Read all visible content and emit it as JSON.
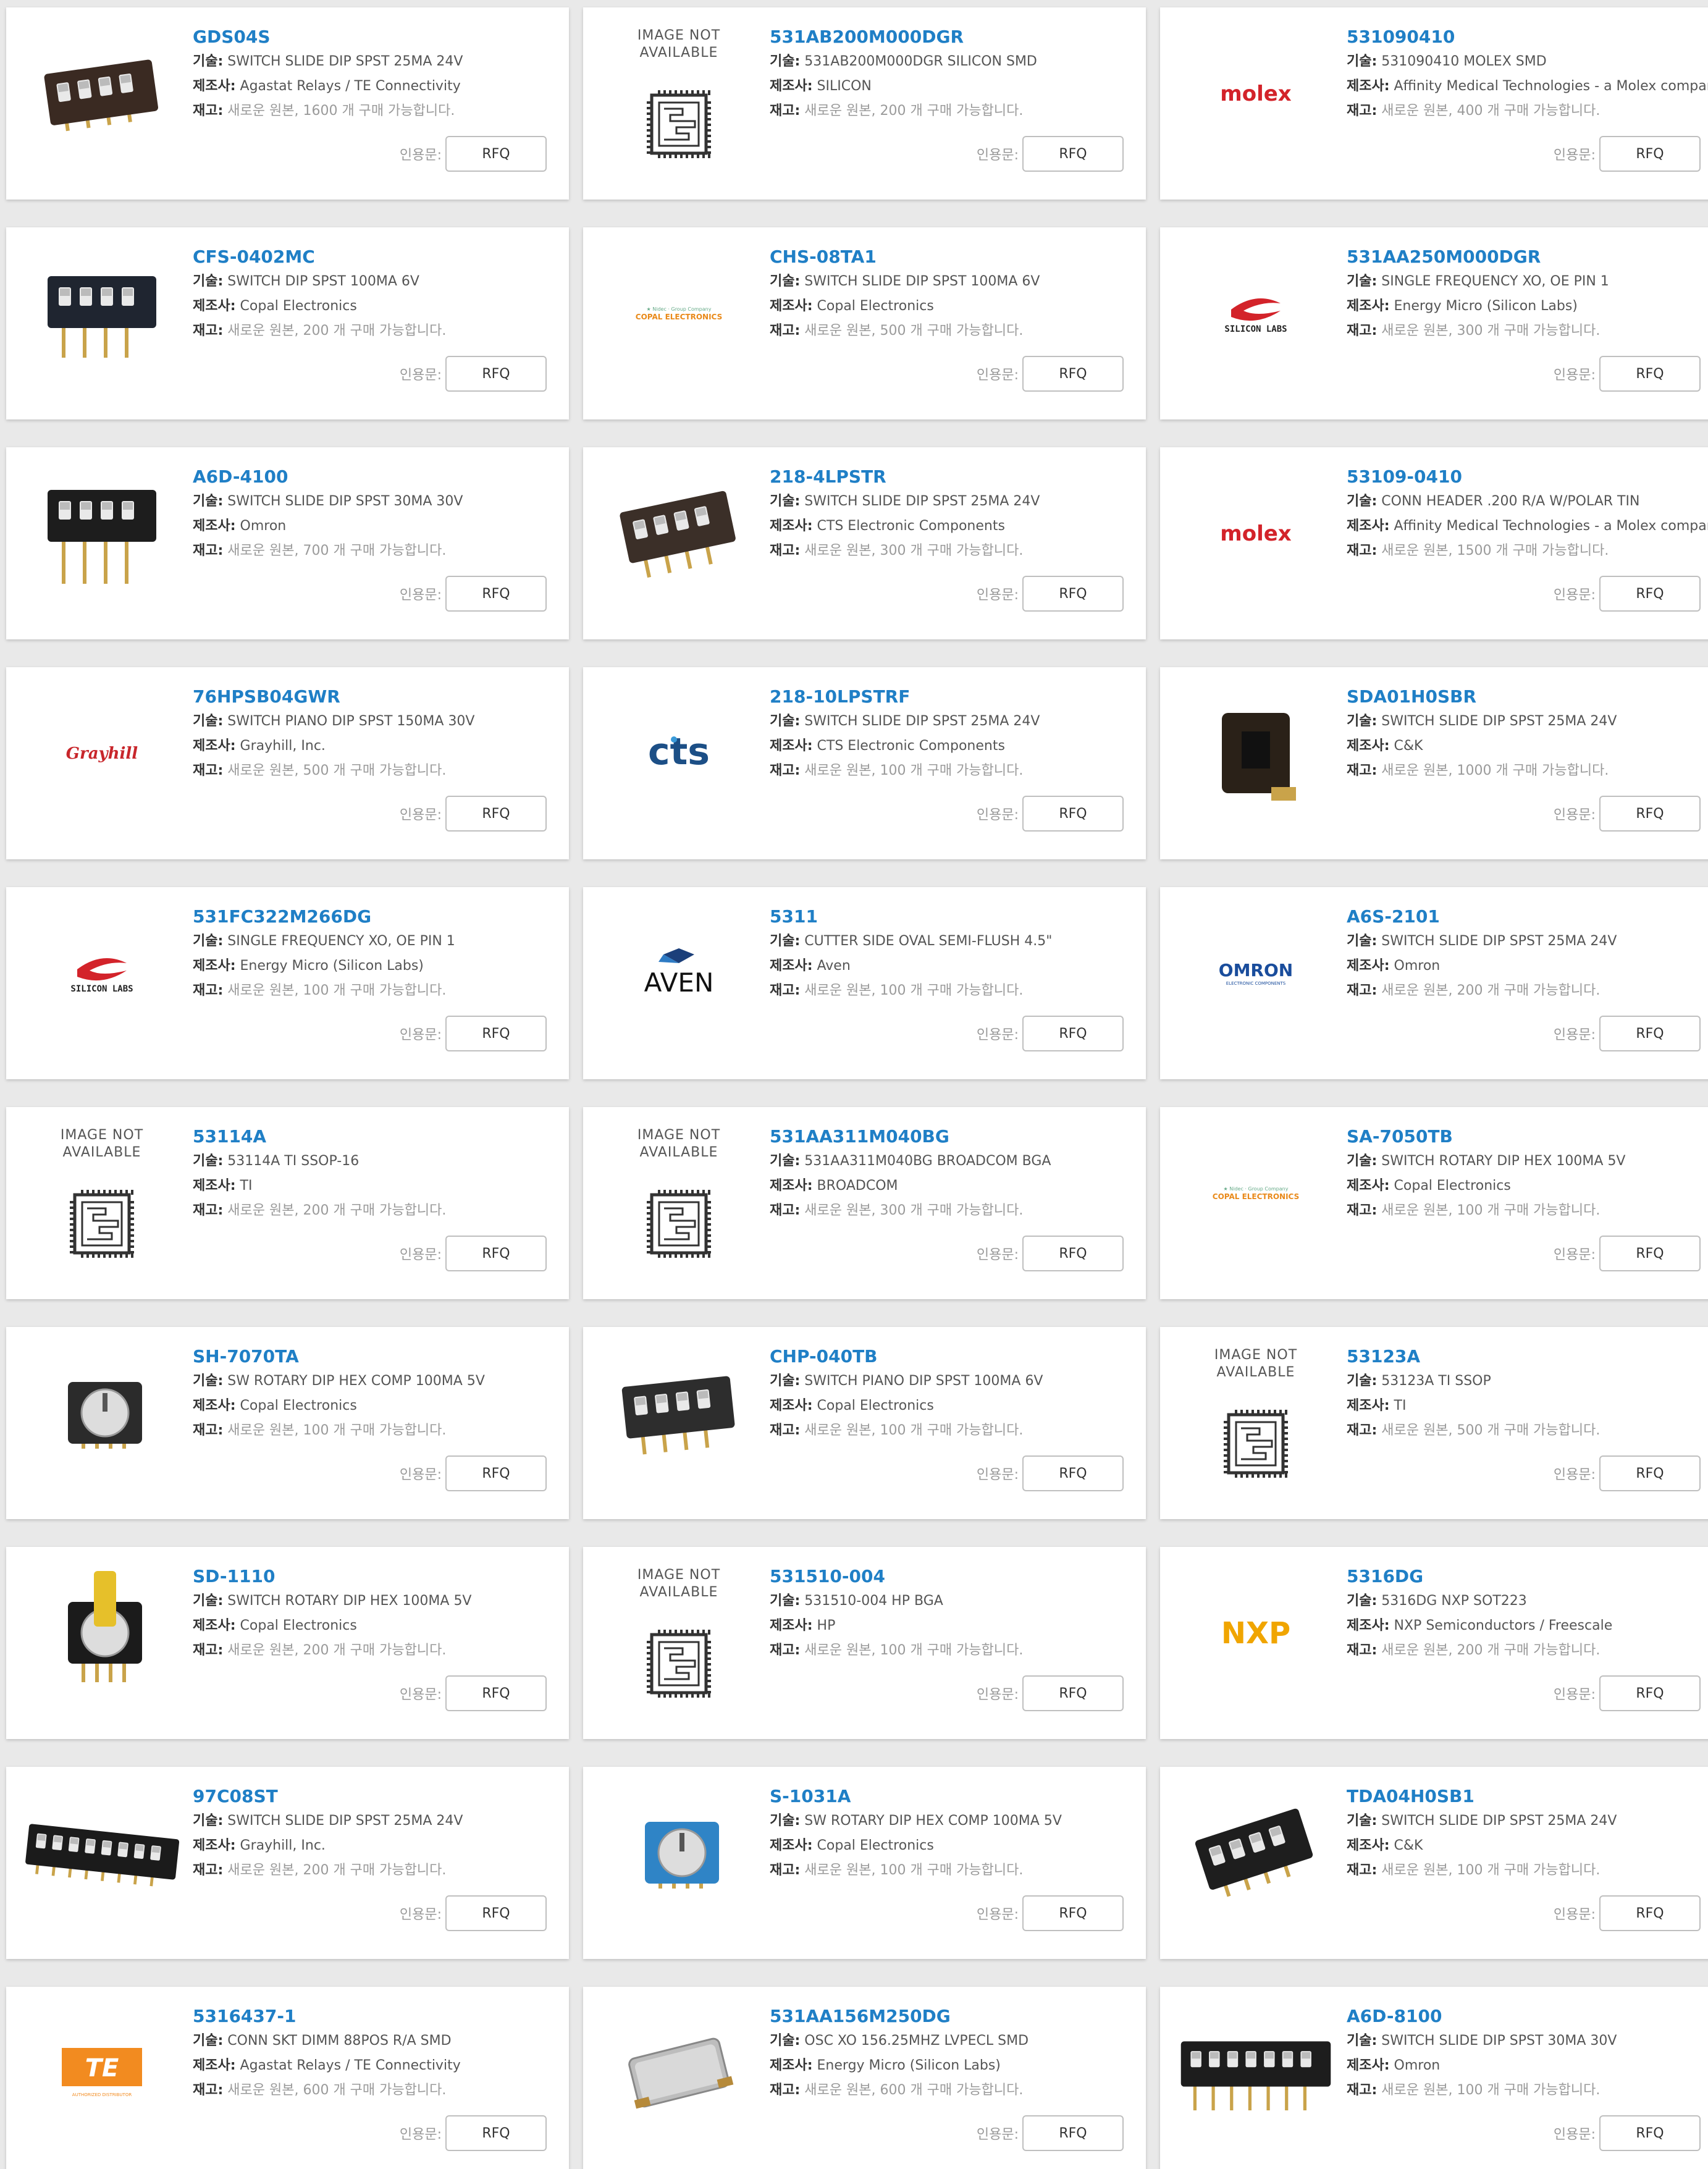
{
  "labels": {
    "tech": "기술:",
    "maker": "제조사:",
    "stock": "재고:",
    "quote": "인용문:",
    "rfq": "RFQ"
  },
  "placeholder_image": {
    "line1": "IMAGE NOT",
    "line2": "AVAILABLE"
  },
  "products": [
    {
      "pn": "GDS04S",
      "tech": "SWITCH SLIDE DIP SPST 25MA 24V",
      "maker": "Agastat Relays / TE Connectivity",
      "stock": "새로운 원본, 1600 개 구매 가능합니다.",
      "image": "dip-slide-smd-icon"
    },
    {
      "pn": "531AB200M000DGR",
      "tech": "531AB200M000DGR SILICON SMD",
      "maker": "SILICON",
      "stock": "새로운 원본, 200 개 구매 가능합니다.",
      "image": "image-not-available-icon"
    },
    {
      "pn": "531090410",
      "tech": "531090410 MOLEX SMD",
      "maker": "Affinity Medical Technologies - a Molex company",
      "stock": "새로운 원본, 400 개 구매 가능합니다.",
      "image": "molex-logo",
      "logo_text": "molex"
    },
    {
      "pn": "CFS-0402MC",
      "tech": "SWITCH DIP SPST 100MA 6V",
      "maker": "Copal Electronics",
      "stock": "새로운 원본, 200 개 구매 가능합니다.",
      "image": "dip-switch-through-hole-icon"
    },
    {
      "pn": "CHS-08TA1",
      "tech": "SWITCH SLIDE DIP SPST 100MA 6V",
      "maker": "Copal Electronics",
      "stock": "새로운 원본, 500 개 구매 가능합니다.",
      "image": "copal-logo",
      "logo_text": "COPAL ELECTRONICS"
    },
    {
      "pn": "531AA250M000DGR",
      "tech": "SINGLE FREQUENCY XO, OE PIN 1",
      "maker": "Energy Micro (Silicon Labs)",
      "stock": "새로운 원본, 300 개 구매 가능합니다.",
      "image": "silicon-labs-logo",
      "logo_text": "SILICON LABS"
    },
    {
      "pn": "A6D-4100",
      "tech": "SWITCH SLIDE DIP SPST 30MA 30V",
      "maker": "Omron",
      "stock": "새로운 원본, 700 개 구매 가능합니다.",
      "image": "dip-switch-long-pins-icon"
    },
    {
      "pn": "218-4LPSTR",
      "tech": "SWITCH SLIDE DIP SPST 25MA 24V",
      "maker": "CTS Electronic Components",
      "stock": "새로운 원본, 300 개 구매 가능합니다.",
      "image": "dip-switch-cts-icon"
    },
    {
      "pn": "53109-0410",
      "tech": "CONN HEADER .200 R/A W/POLAR TIN",
      "maker": "Affinity Medical Technologies - a Molex company",
      "stock": "새로운 원본, 1500 개 구매 가능합니다.",
      "image": "molex-logo",
      "logo_text": "molex"
    },
    {
      "pn": "76HPSB04GWR",
      "tech": "SWITCH PIANO DIP SPST 150MA 30V",
      "maker": "Grayhill, Inc.",
      "stock": "새로운 원본, 500 개 구매 가능합니다.",
      "image": "grayhill-logo",
      "logo_text": "Grayhill"
    },
    {
      "pn": "218-10LPSTRF",
      "tech": "SWITCH SLIDE DIP SPST 25MA 24V",
      "maker": "CTS Electronic Components",
      "stock": "새로운 원본, 100 개 구매 가능합니다.",
      "image": "cts-logo",
      "logo_text": "cts"
    },
    {
      "pn": "SDA01H0SBR",
      "tech": "SWITCH SLIDE DIP SPST 25MA 24V",
      "maker": "C&K",
      "stock": "새로운 원본, 1000 개 구매 가능합니다.",
      "image": "single-dip-switch-icon"
    },
    {
      "pn": "531FC322M266DG",
      "tech": "SINGLE FREQUENCY XO, OE PIN 1",
      "maker": "Energy Micro (Silicon Labs)",
      "stock": "새로운 원본, 100 개 구매 가능합니다.",
      "image": "silicon-labs-logo",
      "logo_text": "SILICON LABS"
    },
    {
      "pn": "5311",
      "tech": "CUTTER SIDE OVAL SEMI-FLUSH 4.5\"",
      "maker": "Aven",
      "stock": "새로운 원본, 100 개 구매 가능합니다.",
      "image": "aven-logo",
      "logo_text": "AVEN"
    },
    {
      "pn": "A6S-2101",
      "tech": "SWITCH SLIDE DIP SPST 25MA 24V",
      "maker": "Omron",
      "stock": "새로운 원본, 200 개 구매 가능합니다.",
      "image": "omron-logo",
      "logo_text": "OMRON"
    },
    {
      "pn": "53114A",
      "tech": "53114A TI SSOP-16",
      "maker": "TI",
      "stock": "새로운 원본, 200 개 구매 가능합니다.",
      "image": "image-not-available-icon"
    },
    {
      "pn": "531AA311M040BG",
      "tech": "531AA311M040BG BROADCOM BGA",
      "maker": "BROADCOM",
      "stock": "새로운 원본, 300 개 구매 가능합니다.",
      "image": "image-not-available-icon"
    },
    {
      "pn": "SA-7050TB",
      "tech": "SWITCH ROTARY DIP HEX 100MA 5V",
      "maker": "Copal Electronics",
      "stock": "새로운 원본, 100 개 구매 가능합니다.",
      "image": "copal-logo",
      "logo_text": "COPAL ELECTRONICS"
    },
    {
      "pn": "SH-7070TA",
      "tech": "SW ROTARY DIP HEX COMP 100MA 5V",
      "maker": "Copal Electronics",
      "stock": "새로운 원본, 100 개 구매 가능합니다.",
      "image": "rotary-switch-icon"
    },
    {
      "pn": "CHP-040TB",
      "tech": "SWITCH PIANO DIP SPST 100MA 6V",
      "maker": "Copal Electronics",
      "stock": "새로운 원본, 100 개 구매 가능합니다.",
      "image": "piano-dip-switch-icon"
    },
    {
      "pn": "53123A",
      "tech": "53123A TI SSOP",
      "maker": "TI",
      "stock": "새로운 원본, 500 개 구매 가능합니다.",
      "image": "image-not-available-icon"
    },
    {
      "pn": "SD-1110",
      "tech": "SWITCH ROTARY DIP HEX 100MA 5V",
      "maker": "Copal Electronics",
      "stock": "새로운 원본, 200 개 구매 가능합니다.",
      "image": "rotary-knob-switch-icon"
    },
    {
      "pn": "531510-004",
      "tech": "531510-004 HP BGA",
      "maker": "HP",
      "stock": "새로운 원본, 100 개 구매 가능합니다.",
      "image": "image-not-available-icon"
    },
    {
      "pn": "5316DG",
      "tech": "5316DG NXP SOT223",
      "maker": "NXP Semiconductors / Freescale",
      "stock": "새로운 원본, 200 개 구매 가능합니다.",
      "image": "nxp-logo",
      "logo_text": "NXP"
    },
    {
      "pn": "97C08ST",
      "tech": "SWITCH SLIDE DIP SPST 25MA 24V",
      "maker": "Grayhill, Inc.",
      "stock": "새로운 원본, 200 개 구매 가능합니다.",
      "image": "dip-switch-8pos-icon"
    },
    {
      "pn": "S-1031A",
      "tech": "SW ROTARY DIP HEX COMP 100MA 5V",
      "maker": "Copal Electronics",
      "stock": "새로운 원본, 100 개 구매 가능합니다.",
      "image": "blue-rotary-switch-icon"
    },
    {
      "pn": "TDA04H0SB1",
      "tech": "SWITCH SLIDE DIP SPST 25MA 24V",
      "maker": "C&K",
      "stock": "새로운 원본, 100 개 구매 가능합니다.",
      "image": "dip-switch-smd-icon"
    },
    {
      "pn": "5316437-1",
      "tech": "CONN SKT DIMM 88POS R/A SMD",
      "maker": "Agastat Relays / TE Connectivity",
      "stock": "새로운 원본, 600 개 구매 가능합니다.",
      "image": "te-logo",
      "logo_text": "TE"
    },
    {
      "pn": "531AA156M250DG",
      "tech": "OSC XO 156.25MHZ LVPECL SMD",
      "maker": "Energy Micro (Silicon Labs)",
      "stock": "새로운 원본, 600 개 구매 가능합니다.",
      "image": "oscillator-icon"
    },
    {
      "pn": "A6D-8100",
      "tech": "SWITCH SLIDE DIP SPST 30MA 30V",
      "maker": "Omron",
      "stock": "새로운 원본, 100 개 구매 가능합니다.",
      "image": "dip-switch-8pos-long-icon"
    }
  ]
}
